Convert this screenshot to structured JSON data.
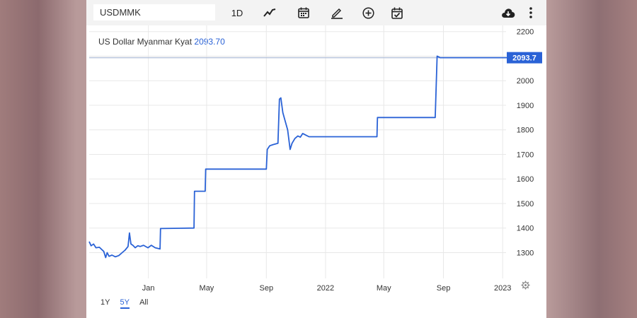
{
  "toolbar": {
    "symbol": "USDMMK",
    "interval_label": "1D",
    "icons": [
      "line-chart-icon",
      "calendar-icon",
      "draw-pencil-icon",
      "add-circle-icon",
      "calendar-check-icon",
      "cloud-download-icon",
      "more-vert-icon"
    ]
  },
  "header": {
    "series_name": "US Dollar Myanmar Kyat",
    "last_value": "2093.70"
  },
  "ranges": [
    {
      "label": "1Y",
      "active": false
    },
    {
      "label": "5Y",
      "active": true
    },
    {
      "label": "All",
      "active": false
    }
  ],
  "colors": {
    "line": "#2a62d6",
    "grid": "#e8e8e8",
    "price_tag": "#2a62d6"
  },
  "chart_data": {
    "type": "line",
    "series": [
      {
        "name": "US Dollar Myanmar Kyat",
        "points": [
          [
            "2020-09-01",
            1345
          ],
          [
            "2020-09-05",
            1328
          ],
          [
            "2020-09-10",
            1335
          ],
          [
            "2020-09-15",
            1320
          ],
          [
            "2020-09-22",
            1322
          ],
          [
            "2020-10-01",
            1305
          ],
          [
            "2020-10-05",
            1280
          ],
          [
            "2020-10-08",
            1300
          ],
          [
            "2020-10-12",
            1285
          ],
          [
            "2020-10-18",
            1290
          ],
          [
            "2020-10-25",
            1283
          ],
          [
            "2020-11-01",
            1288
          ],
          [
            "2020-11-08",
            1300
          ],
          [
            "2020-11-14",
            1310
          ],
          [
            "2020-11-20",
            1325
          ],
          [
            "2020-11-23",
            1380
          ],
          [
            "2020-11-26",
            1335
          ],
          [
            "2020-11-30",
            1330
          ],
          [
            "2020-12-05",
            1320
          ],
          [
            "2020-12-10",
            1328
          ],
          [
            "2020-12-15",
            1325
          ],
          [
            "2020-12-22",
            1330
          ],
          [
            "2020-12-31",
            1320
          ],
          [
            "2021-01-07",
            1330
          ],
          [
            "2021-01-15",
            1320
          ],
          [
            "2021-01-25",
            1315
          ],
          [
            "2021-01-26",
            1398
          ],
          [
            "2021-04-05",
            1400
          ],
          [
            "2021-04-06",
            1550
          ],
          [
            "2021-04-28",
            1550
          ],
          [
            "2021-04-29",
            1640
          ],
          [
            "2021-09-01",
            1640
          ],
          [
            "2021-09-03",
            1720
          ],
          [
            "2021-09-08",
            1735
          ],
          [
            "2021-09-15",
            1740
          ],
          [
            "2021-09-25",
            1745
          ],
          [
            "2021-09-28",
            1925
          ],
          [
            "2021-10-01",
            1930
          ],
          [
            "2021-10-05",
            1870
          ],
          [
            "2021-10-10",
            1835
          ],
          [
            "2021-10-15",
            1800
          ],
          [
            "2021-10-20",
            1720
          ],
          [
            "2021-10-24",
            1745
          ],
          [
            "2021-10-30",
            1765
          ],
          [
            "2021-11-05",
            1775
          ],
          [
            "2021-11-10",
            1770
          ],
          [
            "2021-11-15",
            1785
          ],
          [
            "2021-11-20",
            1780
          ],
          [
            "2021-11-28",
            1772
          ],
          [
            "2022-04-17",
            1772
          ],
          [
            "2022-04-18",
            1850
          ],
          [
            "2022-08-15",
            1850
          ],
          [
            "2022-08-19",
            2100
          ],
          [
            "2022-08-25",
            2093.7
          ],
          [
            "2023-03-10",
            2093.7
          ]
        ]
      }
    ],
    "x_tick_labels": [
      {
        "date": "2021-01-01",
        "label": "Jan"
      },
      {
        "date": "2021-05-01",
        "label": "May"
      },
      {
        "date": "2021-09-01",
        "label": "Sep"
      },
      {
        "date": "2022-01-01",
        "label": "2022"
      },
      {
        "date": "2022-05-01",
        "label": "May"
      },
      {
        "date": "2022-09-01",
        "label": "Sep"
      },
      {
        "date": "2023-01-01",
        "label": "2023"
      }
    ],
    "y_ticks": [
      1300,
      1400,
      1500,
      1600,
      1700,
      1800,
      1900,
      2000,
      2100,
      2200
    ],
    "x_range": [
      "2020-09-01",
      "2023-01-08"
    ],
    "ylim": [
      1195,
      2225
    ],
    "reference_line": 2093.7,
    "last_price_label": "2093.7",
    "grid": true
  }
}
